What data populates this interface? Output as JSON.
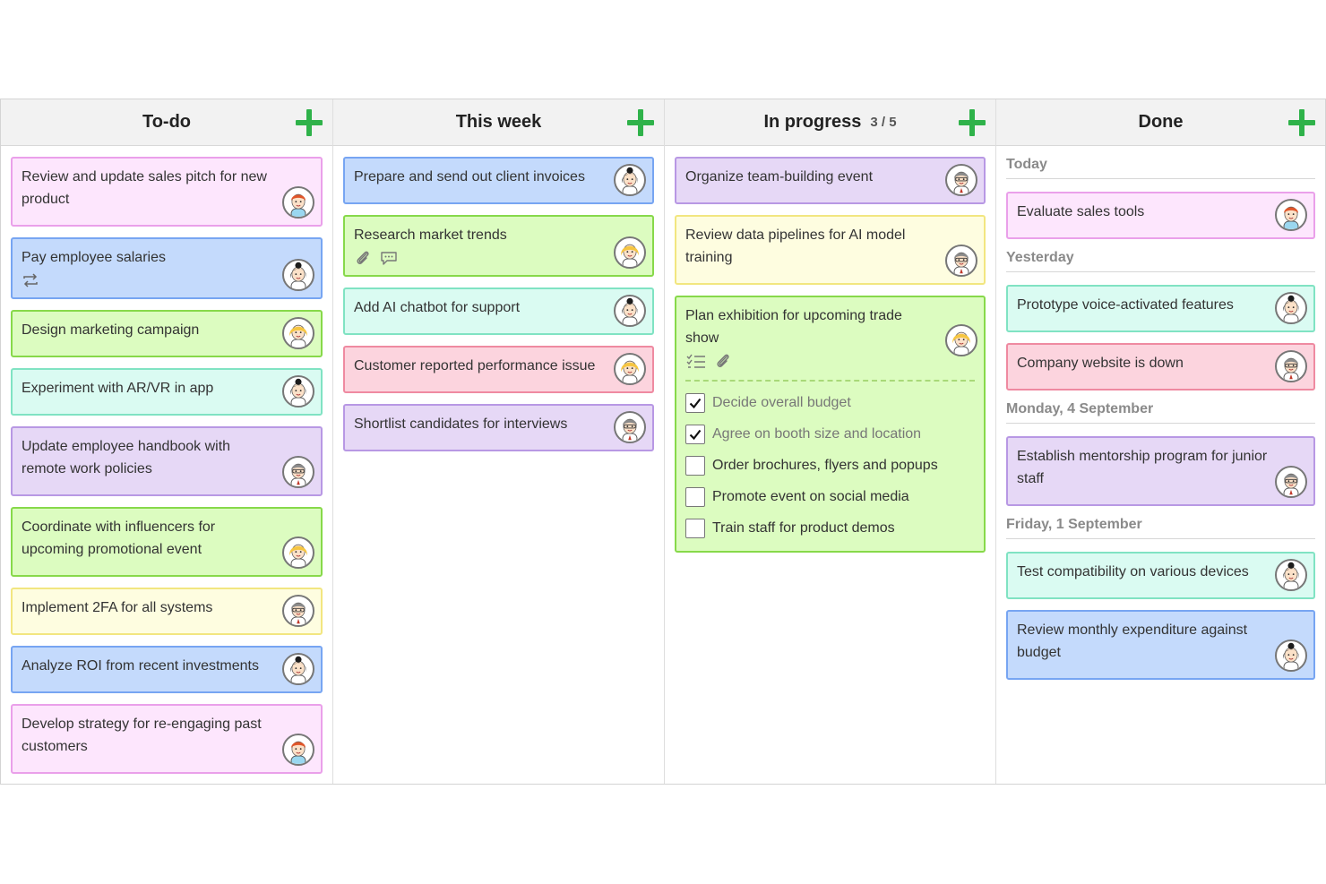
{
  "columns": [
    {
      "title": "To-do",
      "cards": [
        {
          "text": "Review and update sales pitch for new product",
          "color": "pink",
          "avatar": "person-red-hair-icon"
        },
        {
          "text": "Pay employee salaries",
          "color": "blue",
          "avatar": "person-black-hair-woman-icon",
          "icons": [
            "repeat-icon"
          ]
        },
        {
          "text": "Design marketing campaign",
          "color": "green",
          "avatar": "person-blonde-icon"
        },
        {
          "text": "Experiment with AR/VR in app",
          "color": "mint",
          "avatar": "person-black-hair-woman-icon"
        },
        {
          "text": "Update employee handbook with remote work policies",
          "color": "purple",
          "avatar": "person-gray-hair-man-icon"
        },
        {
          "text": "Coordinate with influencers for upcoming promotional event",
          "color": "green",
          "avatar": "person-blonde-icon"
        },
        {
          "text": "Implement 2FA for all systems",
          "color": "yellow",
          "avatar": "person-gray-hair-man-icon"
        },
        {
          "text": "Analyze ROI from recent investments",
          "color": "blue",
          "avatar": "person-black-hair-woman-icon"
        },
        {
          "text": "Develop strategy for re-engaging past customers",
          "color": "pink",
          "avatar": "person-red-hair-icon"
        }
      ]
    },
    {
      "title": "This week",
      "cards": [
        {
          "text": "Prepare and send out client invoices",
          "color": "blue",
          "avatar": "person-black-hair-woman-icon"
        },
        {
          "text": "Research market trends",
          "color": "green",
          "avatar": "person-blonde-icon",
          "icons": [
            "paperclip-icon",
            "comment-icon"
          ]
        },
        {
          "text": "Add AI chatbot for support",
          "color": "mint",
          "avatar": "person-black-hair-woman-icon"
        },
        {
          "text": "Customer reported performance issue",
          "color": "red",
          "avatar": "person-blonde-icon"
        },
        {
          "text": "Shortlist candidates for interviews",
          "color": "purple",
          "avatar": "person-gray-hair-man-icon"
        }
      ]
    },
    {
      "title": "In progress",
      "count": "3 / 5",
      "cards": [
        {
          "text": "Organize team-building event",
          "color": "purple",
          "avatar": "person-gray-hair-man-icon"
        },
        {
          "text": "Review data pipelines for AI model training",
          "color": "yellow",
          "avatar": "person-gray-hair-man-icon"
        }
      ],
      "expanded_card": {
        "text": "Plan exhibition for upcoming trade show",
        "color": "green",
        "avatar": "person-blonde-icon",
        "icons": [
          "checklist-icon",
          "paperclip-icon"
        ],
        "checklist": [
          {
            "label": "Decide overall budget",
            "checked": true
          },
          {
            "label": "Agree on booth size and location",
            "checked": true
          },
          {
            "label": "Order brochures, flyers and popups",
            "checked": false
          },
          {
            "label": "Promote event on social media",
            "checked": false
          },
          {
            "label": "Train staff for product demos",
            "checked": false
          }
        ]
      }
    },
    {
      "title": "Done",
      "sections": [
        {
          "label": "Today",
          "cards": [
            {
              "text": "Evaluate sales tools",
              "color": "pink",
              "avatar": "person-red-hair-icon"
            }
          ]
        },
        {
          "label": "Yesterday",
          "cards": [
            {
              "text": "Prototype voice-activated features",
              "color": "mint",
              "avatar": "person-black-hair-woman-icon"
            },
            {
              "text": "Company website is down",
              "color": "red",
              "avatar": "person-gray-hair-man-icon"
            }
          ]
        },
        {
          "label": "Monday, 4 September",
          "cards": [
            {
              "text": "Establish mentorship program for junior staff",
              "color": "purple",
              "avatar": "person-gray-hair-man-icon"
            }
          ]
        },
        {
          "label": "Friday, 1 September",
          "cards": [
            {
              "text": "Test compatibility on various devices",
              "color": "mint",
              "avatar": "person-black-hair-woman-icon"
            },
            {
              "text": "Review monthly expenditure against budget",
              "color": "blue",
              "avatar": "person-black-hair-woman-icon"
            }
          ]
        }
      ]
    }
  ],
  "colors": {
    "add_button": "#2fb24a",
    "header_bg": "#f2f2f2"
  }
}
